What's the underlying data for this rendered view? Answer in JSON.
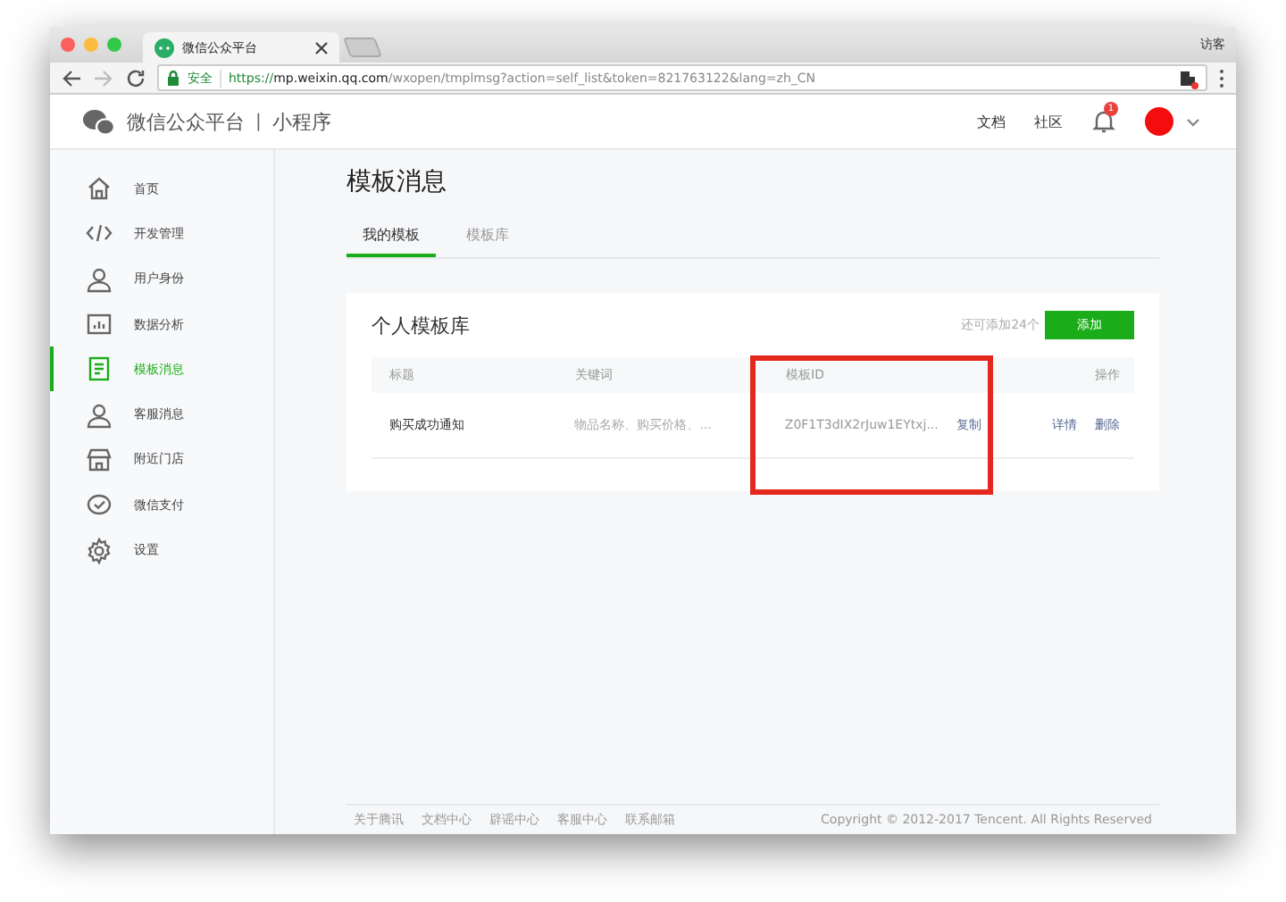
{
  "browser": {
    "tab_title": "微信公众平台",
    "user": "访客",
    "secure_label": "安全",
    "url_scheme": "https://",
    "url_host": "mp.weixin.qq.com",
    "url_path": "/wxopen/tmplmsg?action=self_list&token=821763122&lang=zh_CN"
  },
  "header": {
    "brand": "微信公众平台",
    "separator": "|",
    "product": "小程序",
    "links": [
      "文档",
      "社区"
    ],
    "notification_count": "1"
  },
  "sidebar": {
    "items": [
      {
        "label": "首页",
        "kind": "home",
        "selected": false
      },
      {
        "label": "开发管理",
        "kind": "code",
        "selected": false
      },
      {
        "label": "用户身份",
        "kind": "user",
        "selected": false
      },
      {
        "label": "数据分析",
        "kind": "chart",
        "selected": false
      },
      {
        "label": "模板消息",
        "kind": "doc",
        "selected": true
      },
      {
        "label": "客服消息",
        "kind": "user",
        "selected": false
      },
      {
        "label": "附近门店",
        "kind": "store",
        "selected": false
      },
      {
        "label": "微信支付",
        "kind": "pay",
        "selected": false
      },
      {
        "label": "设置",
        "kind": "gear",
        "selected": false
      }
    ]
  },
  "main": {
    "title": "模板消息",
    "tabs": [
      {
        "label": "我的模板",
        "selected": true
      },
      {
        "label": "模板库",
        "selected": false
      }
    ],
    "card": {
      "title": "个人模板库",
      "remaining": "还可添加24个",
      "add_button": "添加",
      "table": {
        "columns": [
          "标题",
          "关键词",
          "模板ID",
          "操作"
        ],
        "rows": [
          {
            "title": "购买成功通知",
            "keywords": "物品名称、购买价格、...",
            "template_id": "Z0F1T3dIX2rJuw1EYtxj...",
            "copy": "复制",
            "actions": [
              "详情",
              "删除"
            ]
          }
        ]
      }
    }
  },
  "footer": {
    "links": [
      "关于腾讯",
      "文档中心",
      "辟谣中心",
      "客服中心",
      "联系邮箱"
    ],
    "copyright": "Copyright © 2012-2017 Tencent. All Rights Reserved"
  }
}
